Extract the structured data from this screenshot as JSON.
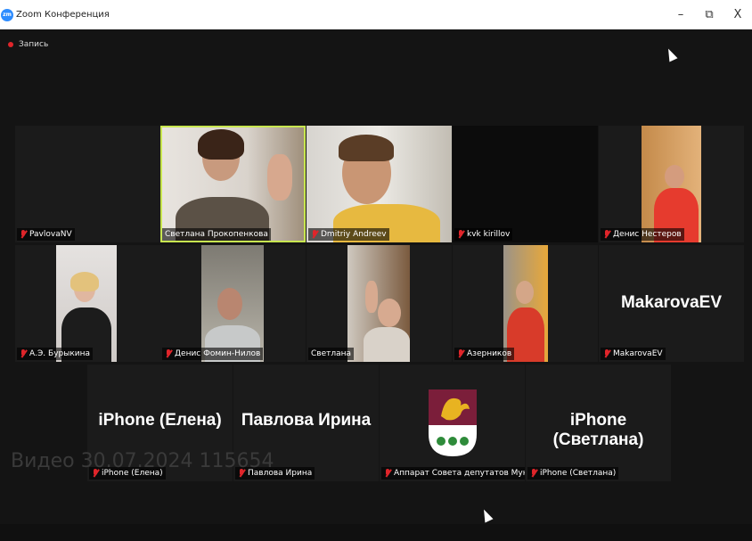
{
  "window": {
    "title": "Zoom Конференция",
    "minimize": "–",
    "restore": "⧉",
    "close": "X"
  },
  "recording": {
    "label": "Запись"
  },
  "watermark": "Видео 30.07.2024 115654",
  "participants": [
    {
      "name": "PavlovaNV"
    },
    {
      "name": "Светлана Прокопенкова"
    },
    {
      "name": "Dmitriy Andreev"
    },
    {
      "name": "kvk kirillov"
    },
    {
      "name": "Денис Нестеров"
    },
    {
      "name": "А.Э. Бурыкина"
    },
    {
      "name": "Денис Фомин-Нилов"
    },
    {
      "name": "Светлана"
    },
    {
      "name": "Азерников"
    },
    {
      "name": "MakarovaEV",
      "display": "MakarovaEV"
    },
    {
      "name": "iPhone (Елена)",
      "display": "iPhone (Елена)"
    },
    {
      "name": "Павлова Ирина",
      "display": "Павлова Ирина"
    },
    {
      "name": "Аппарат Совета депутатов Муници..."
    },
    {
      "name": "iPhone (Светлана)",
      "display": "iPhone (Светлана)"
    }
  ]
}
